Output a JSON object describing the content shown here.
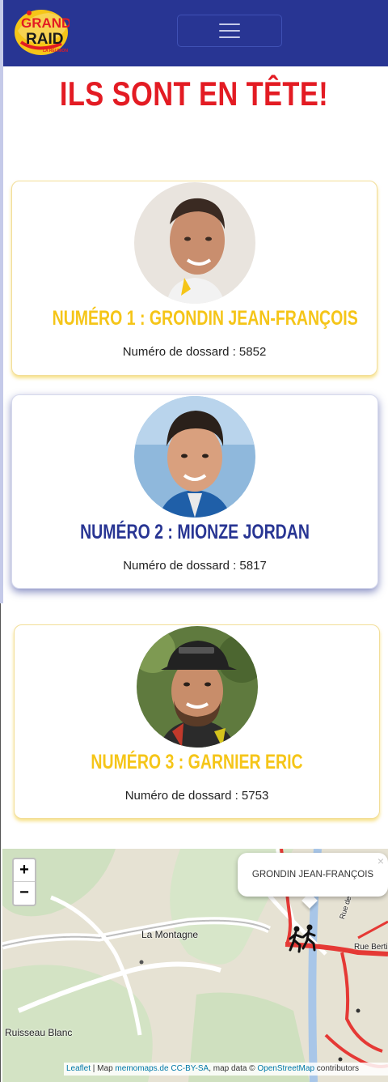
{
  "navbar": {
    "logo_text": "GRAND RAID",
    "logo_subtitle": "LA RÉUNION",
    "menu_icon": "hamburger-icon",
    "brand_color": "#283593"
  },
  "headline": "ILS SONT EN TÊTE!",
  "leaders": [
    {
      "title": "NUMÉRO 1 : GRONDIN JEAN-FRANÇOIS",
      "bib": "Numéro de dossard : 5852",
      "color": "#f5c518"
    },
    {
      "title": "NUMÉRO 2 : MIONZE JORDAN",
      "bib": "Numéro de dossard : 5817",
      "color": "#283593"
    },
    {
      "title": "NUMÉRO 3 : GARNIER ERIC",
      "bib": "Numéro de dossard : 5753",
      "color": "#f5c518"
    }
  ],
  "map": {
    "zoom_in": "+",
    "zoom_out": "−",
    "popup_text": "GRONDIN JEAN-FRANÇOIS",
    "popup_close": "×",
    "labels": {
      "la_montagne": "La Montagne",
      "ruisseau_blanc": "Ruisseau Blanc",
      "rue_de_la_digue": "Rue de la Digue",
      "rue_bertin": "Rue Bertin"
    },
    "marker_icon": "runners-icon",
    "attribution": {
      "leaflet": "Leaflet",
      "sep1": " | Map ",
      "memomaps": "memomaps.de",
      "sep2": " ",
      "license": "CC-BY-SA",
      "sep3": ", map data © ",
      "osm": "OpenStreetMap",
      "sep4": " contributors"
    }
  }
}
